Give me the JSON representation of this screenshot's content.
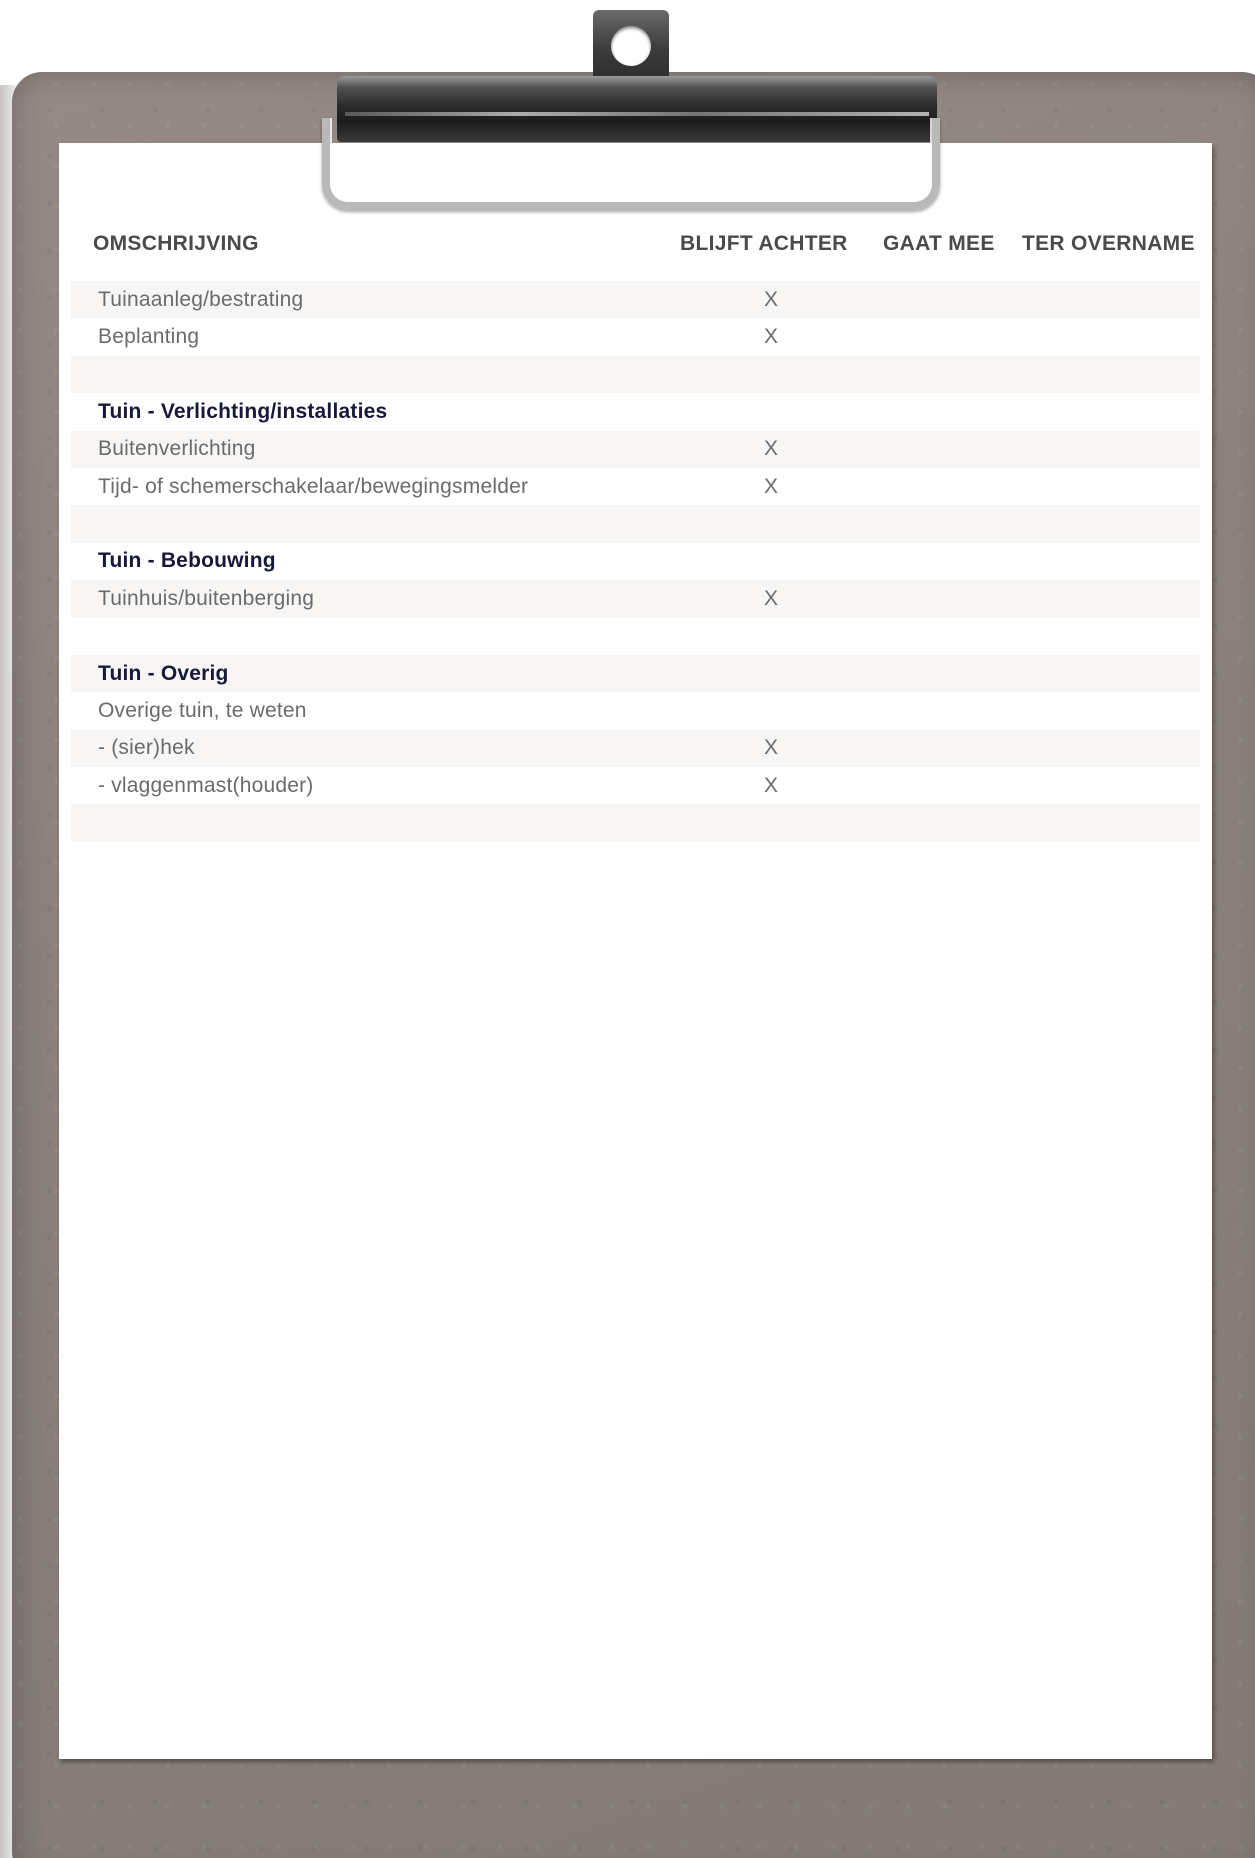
{
  "table": {
    "headers": {
      "description": "OMSCHRIJVING",
      "stays": "BLIJFT ACHTER",
      "goes": "GAAT MEE",
      "takeover": "TER OVERNAME"
    },
    "rows": [
      {
        "label": "Tuinaanleg/bestrating",
        "stays": "X",
        "type": "item",
        "shaded": true
      },
      {
        "label": "Beplanting",
        "stays": "X",
        "type": "item",
        "shaded": false
      },
      {
        "label": "",
        "stays": "",
        "type": "spacer",
        "shaded": true
      },
      {
        "label": "Tuin - Verlichting/installaties",
        "stays": "",
        "type": "section",
        "shaded": false
      },
      {
        "label": "Buitenverlichting",
        "stays": "X",
        "type": "item",
        "shaded": true
      },
      {
        "label": "Tijd- of schemerschakelaar/bewegingsmelder",
        "stays": "X",
        "type": "item",
        "shaded": false
      },
      {
        "label": "",
        "stays": "",
        "type": "spacer",
        "shaded": true
      },
      {
        "label": "Tuin - Bebouwing",
        "stays": "",
        "type": "section",
        "shaded": false
      },
      {
        "label": "Tuinhuis/buitenberging",
        "stays": "X",
        "type": "item",
        "shaded": true
      },
      {
        "label": "",
        "stays": "",
        "type": "spacer",
        "shaded": false
      },
      {
        "label": "Tuin - Overig",
        "stays": "",
        "type": "section",
        "shaded": true
      },
      {
        "label": "Overige tuin, te weten",
        "stays": "",
        "type": "item",
        "shaded": false
      },
      {
        "label": " - (sier)hek",
        "stays": "X",
        "type": "item",
        "shaded": true
      },
      {
        "label": " - vlaggenmast(houder)",
        "stays": "X",
        "type": "item",
        "shaded": false
      },
      {
        "label": "",
        "stays": "",
        "type": "spacer",
        "shaded": true
      }
    ]
  }
}
